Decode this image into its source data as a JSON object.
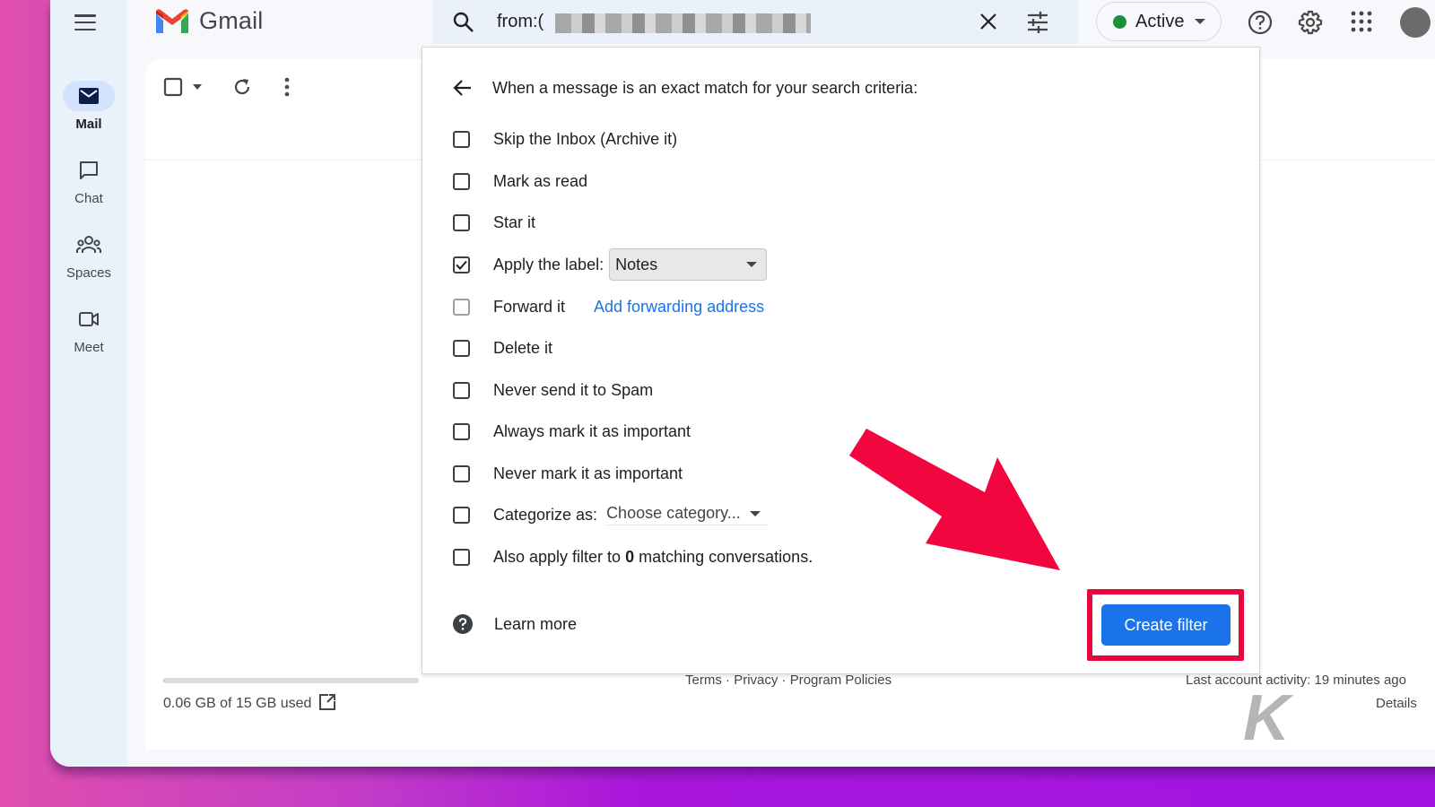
{
  "app": {
    "name": "Gmail",
    "menu_icon": "hamburger-menu-icon",
    "logo_icon": "gmail-m-logo"
  },
  "rail": {
    "items": [
      {
        "label": "Mail",
        "icon": "mail-icon",
        "active": true
      },
      {
        "label": "Chat",
        "icon": "chat-icon",
        "active": false
      },
      {
        "label": "Spaces",
        "icon": "spaces-icon",
        "active": false
      },
      {
        "label": "Meet",
        "icon": "meet-icon",
        "active": false
      }
    ]
  },
  "search": {
    "query_prefix": "from:(",
    "query_redacted": true,
    "icons": [
      "search-icon",
      "clear-icon",
      "search-options-icon"
    ]
  },
  "header": {
    "status": {
      "label": "Active",
      "color": "#1e8e3e"
    },
    "icons": [
      "help-icon",
      "settings-icon",
      "apps-icon",
      "account-avatar"
    ]
  },
  "toolbar": {
    "icons": [
      "select-checkbox",
      "select-dropdown-icon",
      "refresh-icon",
      "more-options-icon"
    ]
  },
  "filter_panel": {
    "title": "When a message is an exact match for your search criteria:",
    "options": [
      {
        "label": "Skip the Inbox (Archive it)",
        "checked": false
      },
      {
        "label": "Mark as read",
        "checked": false
      },
      {
        "label": "Star it",
        "checked": false
      },
      {
        "label": "Apply the label:",
        "checked": true,
        "select_value": "Notes"
      },
      {
        "label": "Forward it",
        "checked": false,
        "disabled": true,
        "link": "Add forwarding address"
      },
      {
        "label": "Delete it",
        "checked": false
      },
      {
        "label": "Never send it to Spam",
        "checked": false
      },
      {
        "label": "Always mark it as important",
        "checked": false
      },
      {
        "label": "Never mark it as important",
        "checked": false
      },
      {
        "label": "Categorize as:",
        "checked": false,
        "select_value": "Choose category..."
      },
      {
        "label_before": "Also apply filter to ",
        "count": "0",
        "label_after": " matching conversations.",
        "checked": false
      }
    ],
    "learn_more": "Learn more",
    "create_button": "Create filter"
  },
  "footer": {
    "storage": {
      "text": "0.06 GB of 15 GB used",
      "used_gb": 0.06,
      "total_gb": 15
    },
    "links": [
      "Terms",
      "Privacy",
      "Program Policies"
    ],
    "separator": " · ",
    "last_activity": "Last account activity: 19 minutes ago",
    "details": "Details"
  },
  "annotation": {
    "arrow_color": "#f2063f",
    "highlight_color": "#e8063d",
    "watermark": "K"
  }
}
